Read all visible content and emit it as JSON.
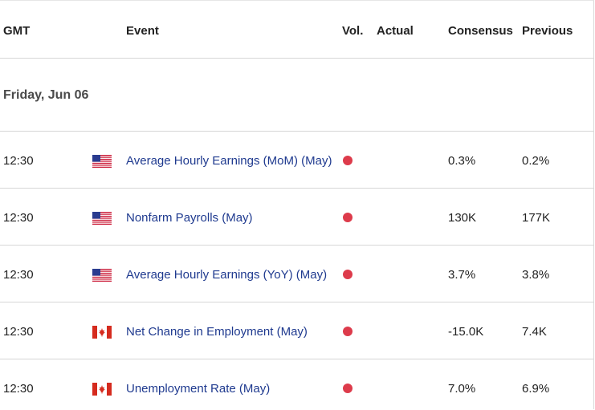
{
  "header": {
    "gmt": "GMT",
    "event": "Event",
    "vol": "Vol.",
    "actual": "Actual",
    "consensus": "Consensus",
    "previous": "Previous"
  },
  "date_label": "Friday, Jun 06",
  "colors": {
    "event_text": "#1f3a8f",
    "volatility_dot": "#dd3b4b",
    "divider": "#d6d6d6"
  },
  "events": [
    {
      "time": "12:30",
      "flag": "us-flag-icon",
      "event": "Average Hourly Earnings (MoM) (May)",
      "actual": "",
      "consensus": "0.3%",
      "previous": "0.2%"
    },
    {
      "time": "12:30",
      "flag": "us-flag-icon",
      "event": "Nonfarm Payrolls (May)",
      "actual": "",
      "consensus": "130K",
      "previous": "177K"
    },
    {
      "time": "12:30",
      "flag": "us-flag-icon",
      "event": "Average Hourly Earnings (YoY) (May)",
      "actual": "",
      "consensus": "3.7%",
      "previous": "3.8%"
    },
    {
      "time": "12:30",
      "flag": "canada-flag-icon",
      "event": "Net Change in Employment (May)",
      "actual": "",
      "consensus": "-15.0K",
      "previous": "7.4K"
    },
    {
      "time": "12:30",
      "flag": "canada-flag-icon",
      "event": "Unemployment Rate (May)",
      "actual": "",
      "consensus": "7.0%",
      "previous": "6.9%"
    }
  ]
}
